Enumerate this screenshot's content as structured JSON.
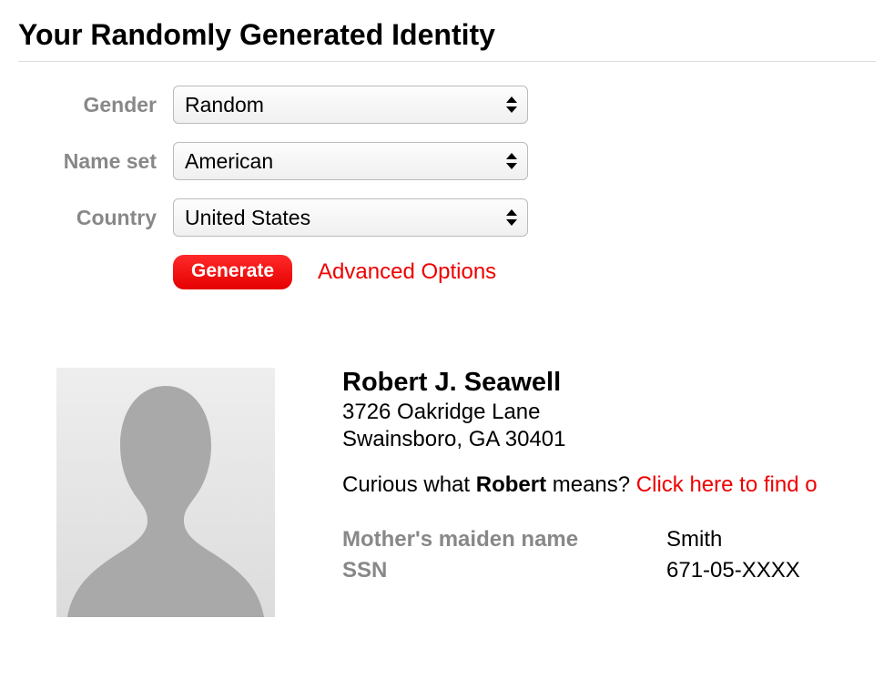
{
  "page": {
    "title": "Your Randomly Generated Identity"
  },
  "form": {
    "labels": {
      "gender": "Gender",
      "nameset": "Name set",
      "country": "Country"
    },
    "values": {
      "gender": "Random",
      "nameset": "American",
      "country": "United States"
    },
    "generate_label": "Generate",
    "advanced_label": "Advanced Options"
  },
  "identity": {
    "name": "Robert J. Seawell",
    "address_line1": "3726 Oakridge Lane",
    "address_line2": "Swainsboro, GA 30401",
    "curious_prefix": "Curious what ",
    "curious_name": "Robert",
    "curious_suffix": " means? ",
    "curious_link": "Click here to find o",
    "meta": [
      {
        "label": "Mother's maiden name",
        "value": "Smith"
      },
      {
        "label": "SSN",
        "value": "671-05-XXXX"
      }
    ]
  },
  "colors": {
    "accent": "#ee0000",
    "muted": "#888888"
  }
}
